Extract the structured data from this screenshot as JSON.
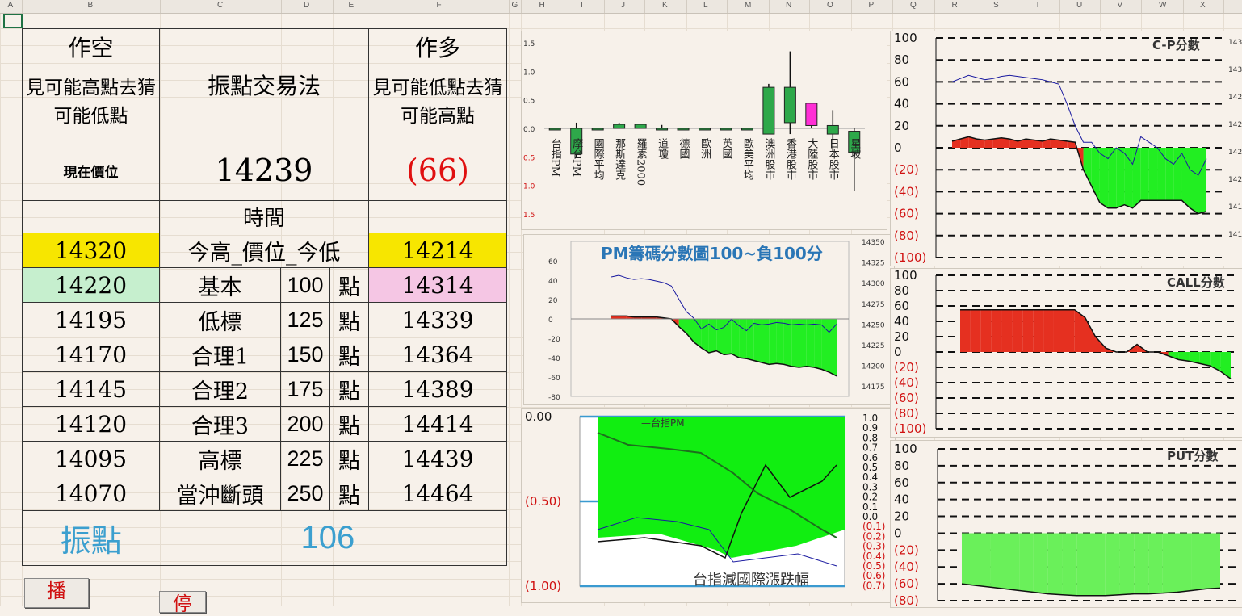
{
  "sheet": {
    "columns": [
      "A",
      "B",
      "C",
      "D",
      "E",
      "F",
      "G",
      "H",
      "I",
      "J",
      "K",
      "L",
      "M",
      "N",
      "O",
      "P",
      "Q",
      "R",
      "S",
      "T",
      "U",
      "V",
      "W",
      "X"
    ]
  },
  "table": {
    "short_header": "作空",
    "long_header": "作多",
    "short_desc": "見可能高點去猜可能低點",
    "long_desc": "見可能低點去猜可能高點",
    "title": "振點交易法",
    "price_label": "現在價位",
    "price": "14239",
    "change": "(66)",
    "time_label": "時間",
    "rows": [
      {
        "left": "14320",
        "label": "今高_價位_今低",
        "right": "14214",
        "pts": "",
        "unit": ""
      },
      {
        "left": "14220",
        "label": "基本",
        "pts": "100",
        "unit": "點",
        "right": "14314"
      },
      {
        "left": "14195",
        "label": "低標",
        "pts": "125",
        "unit": "點",
        "right": "14339"
      },
      {
        "left": "14170",
        "label": "合理1",
        "pts": "150",
        "unit": "點",
        "right": "14364"
      },
      {
        "left": "14145",
        "label": "合理2",
        "pts": "175",
        "unit": "點",
        "right": "14389"
      },
      {
        "left": "14120",
        "label": "合理3",
        "pts": "200",
        "unit": "點",
        "right": "14414"
      },
      {
        "left": "14095",
        "label": "高標",
        "pts": "225",
        "unit": "點",
        "right": "14439"
      },
      {
        "left": "14070",
        "label": "當沖斷頭",
        "pts": "250",
        "unit": "點",
        "right": "14464"
      }
    ],
    "footer_label": "振點",
    "footer_value": "106",
    "colors": {
      "yellow": "#f7e600",
      "green": "#c6efce",
      "pink": "#f5c6e4",
      "label_blue": "#3b9fcf"
    }
  },
  "buttons": {
    "play": "播",
    "stop": "停"
  },
  "chart_data": [
    {
      "type": "bar",
      "title": "",
      "ylim": [
        -1.5,
        1.5
      ],
      "ytick_labels": [
        "1.5",
        "1.0",
        "0.5",
        "0.0",
        "0.5",
        "1.0",
        "1.5"
      ],
      "categories": [
        "台指PM",
        "摩台PM",
        "國際平均",
        "那斯達克",
        "羅素2000",
        "道瓊",
        "德國",
        "歐洲",
        "英國",
        "歐美平均",
        "澳洲股市",
        "香港股市",
        "大陸股市",
        "日本股市",
        "星坡"
      ],
      "open": [
        0.0,
        0.0,
        0.0,
        0.0,
        0.0,
        0.0,
        0.0,
        0.0,
        0.0,
        0.0,
        -0.1,
        0.1,
        0.05,
        -0.1,
        -0.05
      ],
      "close": [
        0.0,
        -0.45,
        0.0,
        0.07,
        0.07,
        0.0,
        0.0,
        0.0,
        0.0,
        0.0,
        0.72,
        0.72,
        0.44,
        0.05,
        -0.42
      ],
      "high": [
        0.0,
        0.1,
        0.0,
        0.1,
        0.08,
        0.06,
        0.0,
        0.0,
        0.0,
        0.0,
        0.78,
        1.35,
        0.45,
        0.32,
        0.0
      ],
      "low": [
        0.0,
        -0.52,
        0.0,
        0.0,
        0.0,
        0.0,
        0.0,
        0.0,
        0.0,
        0.0,
        -0.1,
        -0.1,
        0.0,
        -0.4,
        -1.1
      ],
      "colors": {
        "up": "#2ea84a",
        "pink": "#ff2fd6"
      }
    },
    {
      "type": "area",
      "title": "PM籌碼分數圖100~負100分",
      "ylim": [
        -80,
        80
      ],
      "y_ticks": [
        60,
        40,
        20,
        0,
        -20,
        -40,
        -60,
        -80
      ],
      "y2_ticks": [
        14350,
        14325,
        14300,
        14275,
        14250,
        14225,
        14200,
        14175
      ],
      "score": [
        3,
        3,
        3,
        2,
        2,
        2,
        2,
        1,
        0,
        -8,
        -15,
        -24,
        -30,
        -35,
        -33,
        -37,
        -36,
        -40,
        -41,
        -43,
        -45,
        -47,
        -46,
        -47,
        -49,
        -50,
        -49,
        -50,
        -52,
        -55,
        -59
      ],
      "price_line": [
        14307,
        14309,
        14306,
        14304,
        14305,
        14304,
        14302,
        14300,
        14296,
        14280,
        14265,
        14257,
        14244,
        14250,
        14243,
        14246,
        14256,
        14248,
        14242,
        14251,
        14249,
        14250,
        14252,
        14251,
        14249,
        14250,
        14249,
        14250,
        14249,
        14240,
        14250
      ],
      "colors": {
        "pos": "#e53020",
        "neg": "#22ee22",
        "line": "#1a1aa0"
      }
    },
    {
      "type": "line",
      "title": "台指減國際漲跌幅",
      "legend": "台指PM",
      "ylim_left": [
        -1.0,
        0.0
      ],
      "left_ticks": [
        "0.00",
        "(0.50)",
        "(1.00)"
      ],
      "right_ticks": [
        "1.0",
        "0.9",
        "0.8",
        "0.7",
        "0.6",
        "0.5",
        "0.4",
        "0.3",
        "0.2",
        "0.1",
        "0.0",
        "(0.1)",
        "(0.2)",
        "(0.3)",
        "(0.4)",
        "(0.5)",
        "(0.6)",
        "(0.7)"
      ],
      "colors": {
        "fill": "#11ee11",
        "line": "#1e6e1e",
        "blue": "#1a1aa0",
        "axis": "#3a9ad0"
      }
    },
    {
      "type": "area",
      "title": "C-P分數",
      "ylim": [
        -100,
        100
      ],
      "y_ticks": [
        "100",
        "80",
        "60",
        "40",
        "20",
        "0",
        "(20)",
        "(40)",
        "(60)",
        "(80)",
        "(100)"
      ],
      "y2_ticks": [
        "143",
        "143",
        "142",
        "142",
        "142",
        "142",
        "141",
        "141"
      ],
      "score": [
        6,
        8,
        10,
        8,
        7,
        8,
        9,
        8,
        6,
        8,
        7,
        6,
        8,
        7,
        6,
        5,
        -20,
        -35,
        -50,
        -55,
        -55,
        -52,
        -55,
        -48,
        -48,
        -48,
        -48,
        -48,
        -48,
        -55,
        -60,
        -58
      ],
      "colors": {
        "pos": "#e53020",
        "neg": "#22ee22",
        "line": "#1a1aa0"
      }
    },
    {
      "type": "area",
      "title": "CALL分數",
      "ylim": [
        -100,
        100
      ],
      "y_ticks": [
        "100",
        "80",
        "60",
        "40",
        "20",
        "0",
        "(20)",
        "(40)",
        "(60)",
        "(80)",
        "(100)"
      ],
      "score": [
        55,
        55,
        55,
        55,
        55,
        55,
        55,
        55,
        55,
        55,
        55,
        55,
        45,
        20,
        5,
        0,
        0,
        10,
        0,
        0,
        -5,
        -10,
        -12,
        -15,
        -18,
        -25,
        -35
      ],
      "colors": {
        "pos": "#e53020",
        "neg": "#22ee22",
        "line": "#222222"
      }
    },
    {
      "type": "area",
      "title": "PUT分數",
      "ylim": [
        -80,
        100
      ],
      "y_ticks": [
        "100",
        "80",
        "60",
        "40",
        "20",
        "0",
        "(20)",
        "(40)",
        "(60)",
        "(80)"
      ],
      "score": [
        -60,
        -62,
        -64,
        -66,
        -68,
        -70,
        -72,
        -73,
        -74,
        -74,
        -74,
        -73,
        -72,
        -72,
        -71,
        -70,
        -68,
        -66,
        -65
      ],
      "colors": {
        "pos": "#e53020",
        "neg": "#6af05a",
        "line": "#222222"
      }
    }
  ]
}
